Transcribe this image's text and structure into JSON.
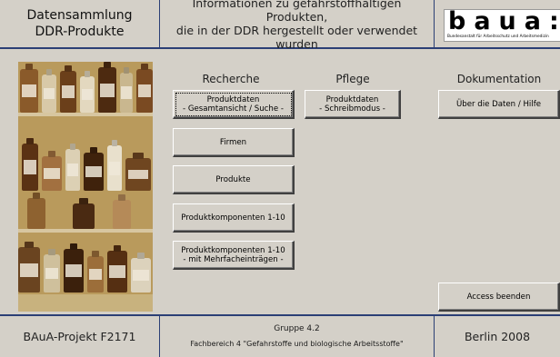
{
  "header": {
    "title_line1": "Datensammlung",
    "title_line2": "DDR-Produkte",
    "info_line1": "Informationen zu gefahrstoffhaltigen Produkten,",
    "info_line2": "die in der DDR hergestellt oder verwendet wurden",
    "logo_text": "baua:",
    "logo_subtext": "Bundesanstalt für Arbeitsschutz und Arbeitsmedizin"
  },
  "columns": {
    "recherche": "Recherche",
    "pflege": "Pflege",
    "dokumentation": "Dokumentation"
  },
  "buttons": {
    "produktdaten_suche_l1": "Produktdaten",
    "produktdaten_suche_l2": "- Gesamtansicht / Suche -",
    "firmen": "Firmen",
    "produkte": "Produkte",
    "produktkomponenten": "Produktkomponenten 1-10",
    "produktkomponenten_mehrfach_l1": "Produktkomponenten 1-10",
    "produktkomponenten_mehrfach_l2": "- mit Mehrfacheinträgen -",
    "produktdaten_schreib_l1": "Produktdaten",
    "produktdaten_schreib_l2": "- Schreibmodus -",
    "ueber_daten": "Über die Daten / Hilfe",
    "access_beenden": "Access beenden"
  },
  "footer": {
    "projekt": "BAuA-Projekt F2171",
    "gruppe": "Gruppe 4.2",
    "fachbereich": "Fachbereich 4 \"Gefahrstoffe und biologische Arbeitsstoffe\"",
    "ort_jahr": "Berlin 2008"
  }
}
